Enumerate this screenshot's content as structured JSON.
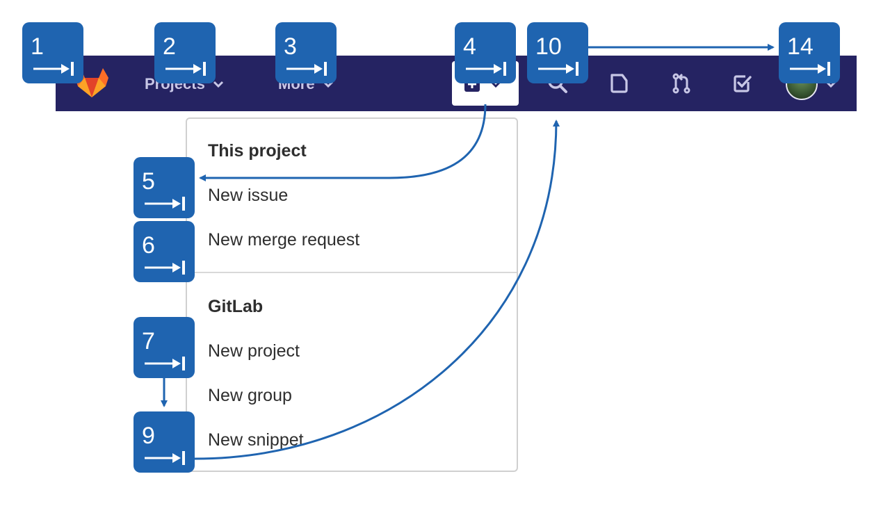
{
  "colors": {
    "navbar_bg": "#252362",
    "nav_text": "#c8c7e6",
    "badge_bg": "#1f64b0",
    "arrow": "#1f64b0",
    "logo_orange": "#e24329"
  },
  "navbar": {
    "logo_icon": "gitlab-tanuki-logo",
    "projects_label": "Projects",
    "more_label": "More",
    "new_icon": "plus-square-icon",
    "search_icon": "search-icon",
    "issues_icon": "issues-icon",
    "merge_requests_icon": "merge-request-icon",
    "todos_icon": "todo-checkbox-icon",
    "avatar_icon": "user-avatar"
  },
  "dropdown": {
    "section1_header": "This project",
    "section1_items": [
      "New issue",
      "New merge request"
    ],
    "section2_header": "GitLab",
    "section2_items": [
      "New project",
      "New group",
      "New snippet"
    ]
  },
  "badges": {
    "b1": "1",
    "b2": "2",
    "b3": "3",
    "b4": "4",
    "b5": "5",
    "b6": "6",
    "b7": "7",
    "b9": "9",
    "b10": "10",
    "b14": "14"
  }
}
